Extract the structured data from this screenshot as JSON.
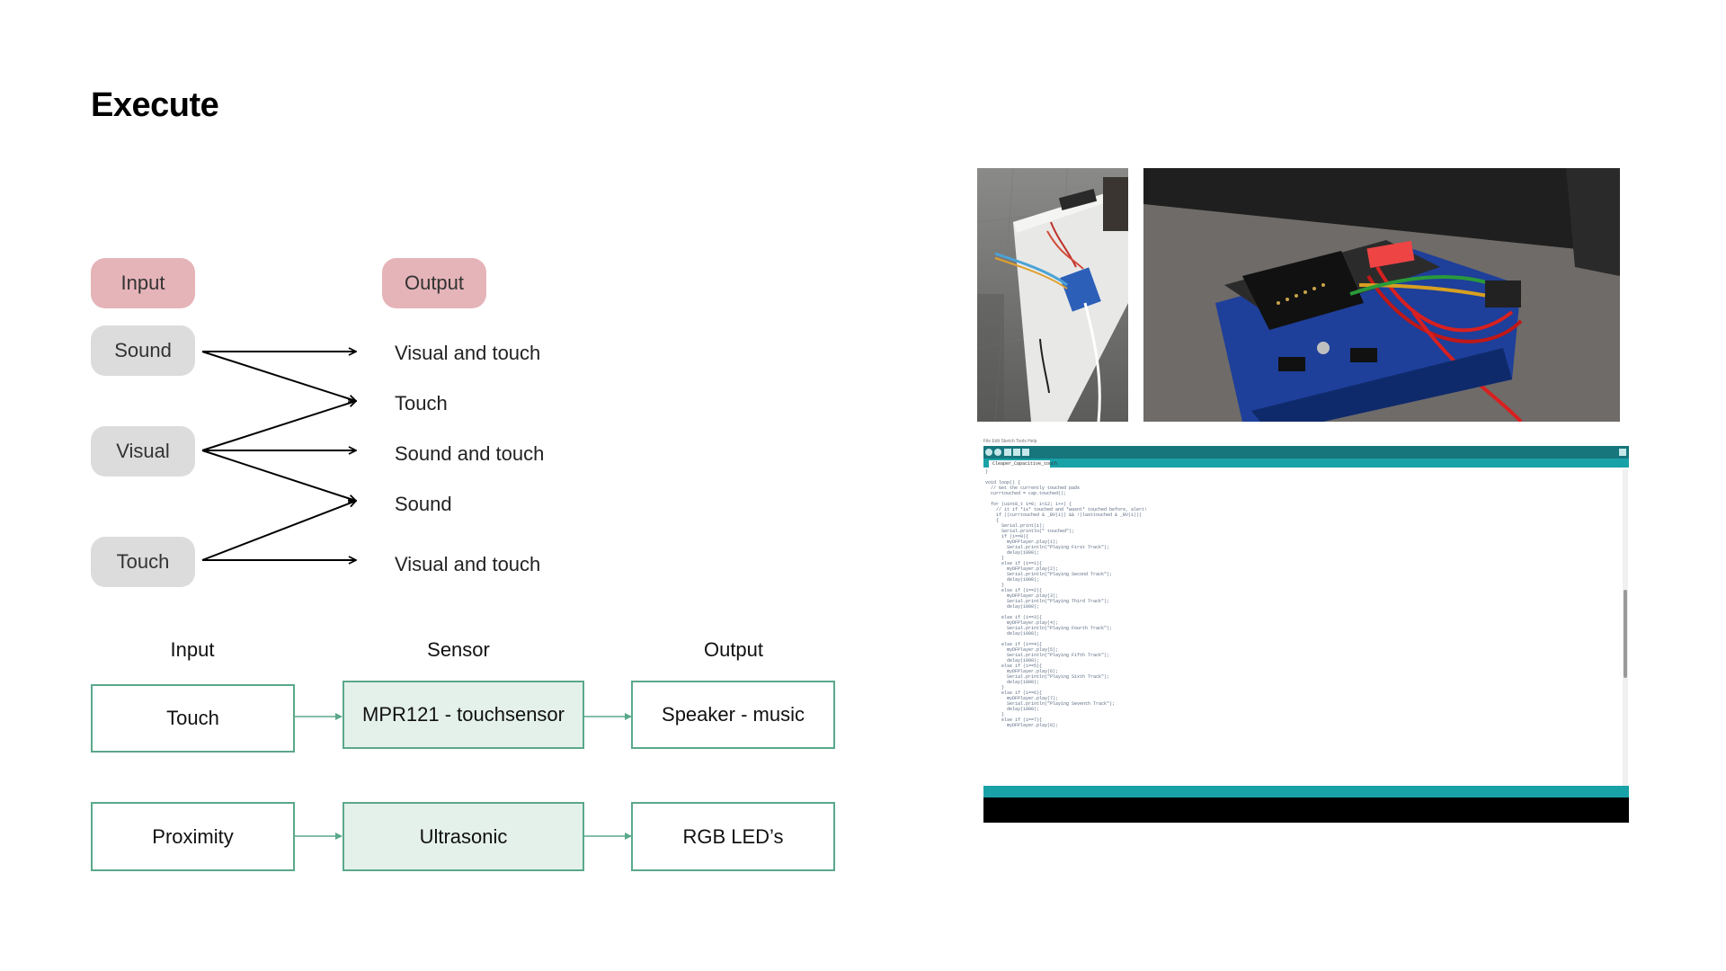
{
  "title": "Execute",
  "mapping": {
    "input_header": "Input",
    "output_header": "Output",
    "inputs": [
      "Sound",
      "Visual",
      "Touch"
    ],
    "outputs": [
      "Visual and touch",
      "Touch",
      "Sound and touch",
      "Sound",
      "Visual and touch"
    ]
  },
  "flow": {
    "headers": {
      "input": "Input",
      "sensor": "Sensor",
      "output": "Output"
    },
    "rows": [
      {
        "input": "Touch",
        "sensor": "MPR121 - touchsensor",
        "output": "Speaker - music"
      },
      {
        "input": "Proximity",
        "sensor": "Ultrasonic",
        "output": "RGB LED’s"
      }
    ]
  },
  "colors": {
    "pill_header": "#e5b4b8",
    "pill_input": "#dcdcdc",
    "box_border": "#5aa88a",
    "sensor_fill": "#e4f1eb",
    "ide_dark": "#17757c",
    "ide_teal": "#18a2a8"
  },
  "ide": {
    "menu": "File Edit Sketch Tools Help",
    "tab": "Cleaper_Capacitive_touch",
    "code": "}\n\nvoid loop() {\n  // Get the currently touched pads\n  currtouched = cap.touched();\n\n  for (uint8_t i=0; i<12; i++) {\n    // it if *is* touched and *wasnt* touched before, alert!\n    if ((currtouched & _BV(i)) && !(lasttouched & _BV(i)))\n    {\n      Serial.print(i);\n      Serial.println(\" touched\");\n      if (i==0){\n        myDFPlayer.play(1);\n        Serial.println(\"Playing First Track\");\n        delay(1000);\n      }\n      else if (i==1){\n        myDFPlayer.play(2);\n        Serial.println(\"Playing Second Track\");\n        delay(1000);\n      }\n      else if (i==2){\n        myDFPlayer.play(3);\n        Serial.println(\"Playing Third Track\");\n        delay(1000);\n\n      else if (i==3){\n        myDFPlayer.play(4);\n        Serial.println(\"Playing Fourth Track\");\n        delay(1000);\n\n      else if (i==4){\n        myDFPlayer.play(5);\n        Serial.println(\"Playing Fifth Track\");\n        delay(1000);\n      else if (i==5){\n        myDFPlayer.play(6);\n        Serial.println(\"Playing Sixth Track\");\n        delay(1000);\n      }\n      else if (i==6){\n        myDFPlayer.play(7);\n        Serial.println(\"Playing Seventh Track\");\n        delay(1000);\n      }\n      else if (i==7){\n        myDFPlayer.play(8);"
  }
}
